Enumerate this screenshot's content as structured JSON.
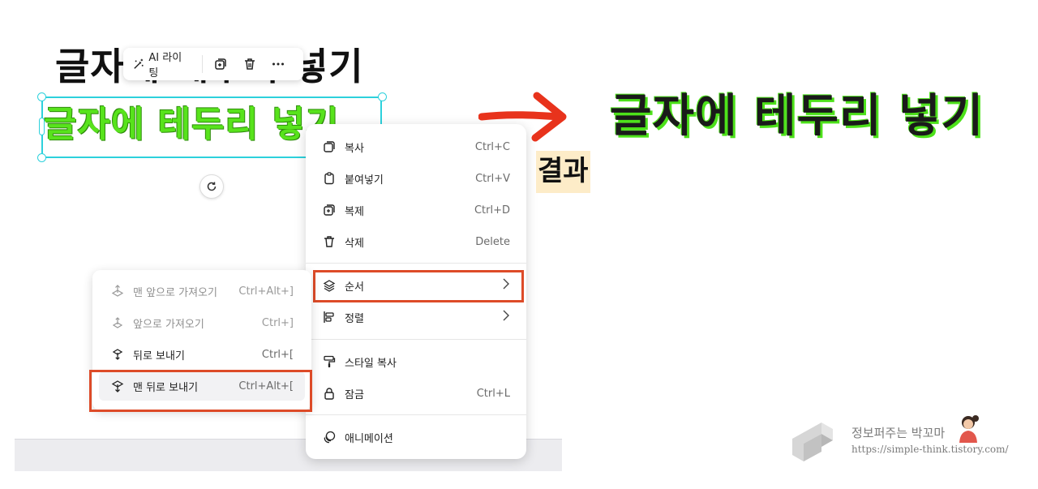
{
  "canvas": {
    "headline_black": "글자에 테두리 넣기",
    "headline_green": "글자에 테두리 넣기"
  },
  "toolbar": {
    "ai_label": "AI 라이팅",
    "duplicate_icon": "duplicate-icon",
    "delete_icon": "trash-icon",
    "more_icon": "more-icon"
  },
  "context_menu": {
    "items": [
      {
        "label": "복사",
        "shortcut": "Ctrl+C",
        "icon": "copy-icon"
      },
      {
        "label": "붙여넣기",
        "shortcut": "Ctrl+V",
        "icon": "clipboard-icon"
      },
      {
        "label": "복제",
        "shortcut": "Ctrl+D",
        "icon": "duplicate-icon"
      },
      {
        "label": "삭제",
        "shortcut": "Delete",
        "icon": "trash-icon"
      },
      {
        "label": "순서",
        "shortcut": "",
        "icon": "layers-icon",
        "submenu": true
      },
      {
        "label": "정렬",
        "shortcut": "",
        "icon": "align-icon",
        "submenu": true
      },
      {
        "label": "스타일 복사",
        "shortcut": "",
        "icon": "paint-roller-icon"
      },
      {
        "label": "잠금",
        "shortcut": "Ctrl+L",
        "icon": "lock-icon"
      },
      {
        "label": "애니메이션",
        "shortcut": "",
        "icon": "animation-icon"
      }
    ]
  },
  "order_submenu": {
    "items": [
      {
        "label": "맨 앞으로 가져오기",
        "shortcut": "Ctrl+Alt+]",
        "disabled": true
      },
      {
        "label": "앞으로 가져오기",
        "shortcut": "Ctrl+]",
        "disabled": true
      },
      {
        "label": "뒤로 보내기",
        "shortcut": "Ctrl+[",
        "disabled": false
      },
      {
        "label": "맨 뒤로 보내기",
        "shortcut": "Ctrl+Alt+[",
        "disabled": false
      }
    ]
  },
  "annotation": {
    "result_text": "글자에 테두리 넣기",
    "result_label": "결과",
    "arrow_color": "#e8331c",
    "highlight_color": "#dd4b28",
    "accent_green": "#58e31c"
  },
  "watermark": {
    "name": "정보퍼주는 박꼬마",
    "url": "https://simple-think.tistory.com/"
  }
}
